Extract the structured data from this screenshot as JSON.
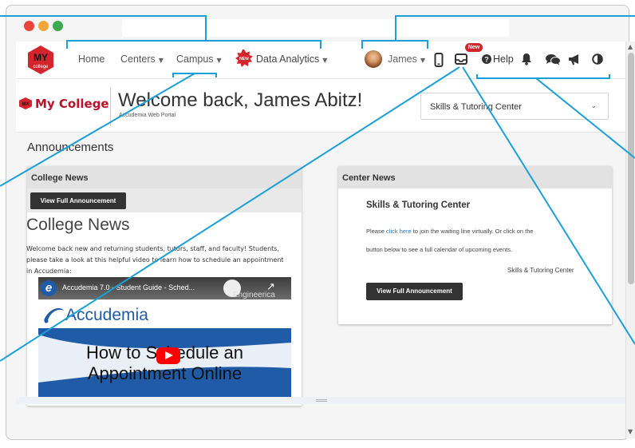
{
  "nav": {
    "logo_top": "MY",
    "logo_bottom": "college",
    "home": "Home",
    "centers": "Centers",
    "campus": "Campus",
    "new_badge": "NEW",
    "analytics": "Data Analytics",
    "user": "James",
    "new_flag": "New",
    "help": "Help"
  },
  "header": {
    "mx": "MX",
    "brand": "My College",
    "welcome": "Welcome back, James Abitz!",
    "portal": "Accudemia Web Portal",
    "center_select": "Skills & Tutoring Center"
  },
  "announcements": {
    "title": "Announcements",
    "college": {
      "header": "College News",
      "button": "View Full Announcement",
      "big": "College News",
      "paragraph": "Welcome back new and returning students, tutors, staff, and faculty! Students, please take a look at this helpful video to learn how to schedule an appointment in Accudemia:"
    },
    "center": {
      "header": "Center News",
      "title": "Skills & Tutoring Center",
      "line1_a": "Please ",
      "line1_link": "click here",
      "line1_b": " to join the waiting line virtually.  Or click on the",
      "line2": "button below to see a full calendar of upcoming events.",
      "signature": "Skills & Tutoring Center",
      "button": "View Full Announcement"
    }
  },
  "video": {
    "title": "Accudemia 7.0 - Student Guide - Sched...",
    "channel": "Engineerica",
    "brand": "Accudemia",
    "line1": "How to Schedule an",
    "line2": "Appointment Online"
  },
  "colors": {
    "accent_red": "#d4252f",
    "callout_blue": "#1a9fd9",
    "brand_maroon": "#b9132a"
  }
}
